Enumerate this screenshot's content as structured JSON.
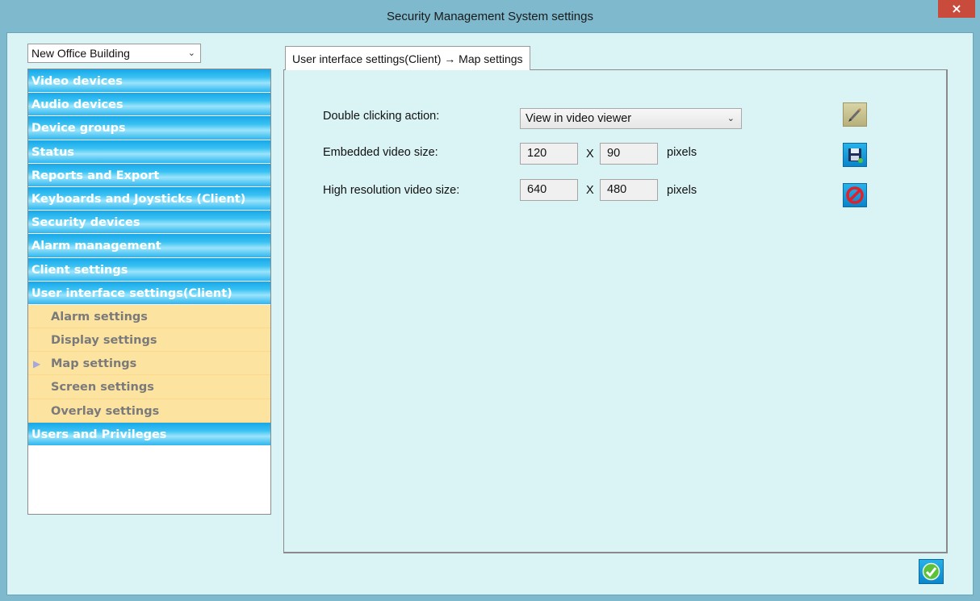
{
  "window": {
    "title": "Security Management System settings",
    "close_label": "×"
  },
  "site_selector": {
    "value": "New Office Building",
    "chevron": "⌄"
  },
  "nav": {
    "items": [
      {
        "label": "Video devices",
        "type": "group"
      },
      {
        "label": "Audio devices",
        "type": "group"
      },
      {
        "label": "Device groups",
        "type": "group"
      },
      {
        "label": "Status",
        "type": "group"
      },
      {
        "label": "Reports and Export",
        "type": "group"
      },
      {
        "label": "Keyboards and Joysticks (Client)",
        "type": "group"
      },
      {
        "label": "Security devices",
        "type": "group"
      },
      {
        "label": "Alarm management",
        "type": "group"
      },
      {
        "label": "Client settings",
        "type": "group"
      },
      {
        "label": "User interface settings(Client)",
        "type": "group"
      },
      {
        "label": "Alarm settings",
        "type": "sub"
      },
      {
        "label": "Display settings",
        "type": "sub"
      },
      {
        "label": "Map settings",
        "type": "sub",
        "selected": true
      },
      {
        "label": "Screen settings",
        "type": "sub"
      },
      {
        "label": "Overlay settings",
        "type": "sub"
      },
      {
        "label": "Users and Privileges",
        "type": "group"
      }
    ],
    "selected_marker": "▶"
  },
  "tab": {
    "label": "User interface settings(Client) → Map settings"
  },
  "form": {
    "double_click": {
      "label": "Double clicking action:",
      "value": "View in video viewer"
    },
    "embedded": {
      "label": "Embedded video size:",
      "width": "120",
      "sep": "X",
      "height": "90",
      "unit": "pixels"
    },
    "highres": {
      "label": "High resolution video size:",
      "width": "640",
      "sep": "X",
      "height": "480",
      "unit": "pixels"
    }
  },
  "toolbar": {
    "edit_icon": "pencil-icon",
    "save_icon": "floppy-disk-icon",
    "cancel_icon": "no-entry-icon"
  },
  "footer": {
    "ok_icon": "checkmark-icon"
  },
  "colors": {
    "nav_group": "#2db6ef",
    "nav_sub": "#fde3a0",
    "panel_bg": "#daf3f4",
    "frame": "#7fb9cd"
  }
}
